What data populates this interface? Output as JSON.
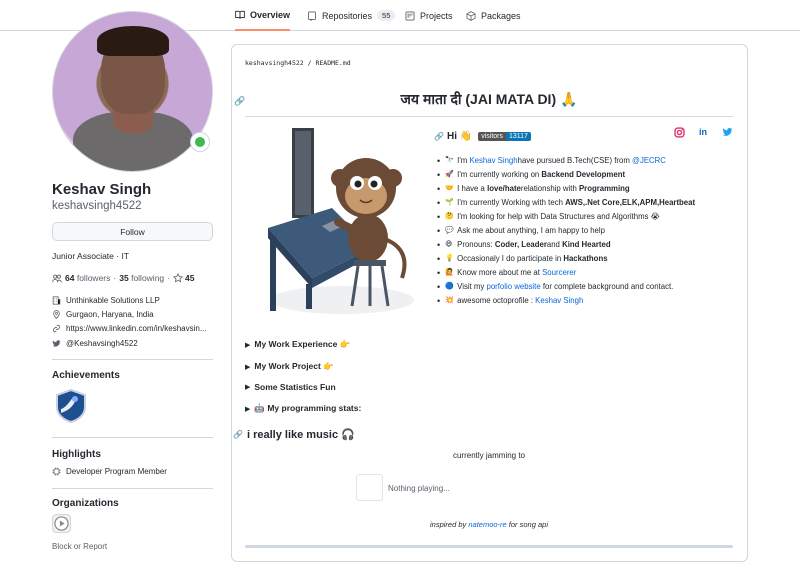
{
  "tabs": [
    {
      "label": "Overview",
      "icon": "book-icon"
    },
    {
      "label": "Repositories",
      "icon": "repo-icon",
      "count": "55"
    },
    {
      "label": "Projects",
      "icon": "project-icon"
    },
    {
      "label": "Packages",
      "icon": "package-icon"
    }
  ],
  "profile": {
    "name": "Keshav Singh",
    "login": "keshavsingh4522",
    "follow_label": "Follow",
    "bio": "Junior Associate · IT",
    "followers_count": "64",
    "followers_label": "followers",
    "following_count": "35",
    "following_label": "following",
    "separator": "·",
    "stars_count": "45",
    "company": "Unthinkable Solutions LLP",
    "location": "Gurgaon, Haryana, India",
    "website": "https://www.linkedin.com/in/keshavsin...",
    "twitter": "@Keshavsingh4522"
  },
  "sidebar": {
    "achievements_title": "Achievements",
    "highlights_title": "Highlights",
    "highlight_item": "Developer Program Member",
    "organizations_title": "Organizations",
    "block_label": "Block or Report"
  },
  "readme": {
    "breadcrumb_user": "keshavsingh4522",
    "breadcrumb_sep": " / ",
    "breadcrumb_file": "README.md",
    "heading": "जय माता दी (JAI MATA DI) 🙏",
    "hi": "Hi 👋",
    "visitors_label": "visitors",
    "visitors_count": "13117",
    "bullets": [
      {
        "emoji": "🔭",
        "pre": "I'm ",
        "link1": "Keshav Singh",
        "mid": " have pursued B.Tech(CSE) from ",
        "link2": "@JECRC",
        "post": ""
      },
      {
        "emoji": "🚀",
        "pre": "I'm currently working on ",
        "bold": "Backend Development",
        "post": ""
      },
      {
        "emoji": "🤝",
        "pre": "I have a ",
        "bold": "love/hate",
        "post": " relationship with ",
        "bold2": "Programming"
      },
      {
        "emoji": "🌱",
        "pre": "I'm currently Working with tech ",
        "bold": "AWS,.Net Core,ELK,APM,Heartbeat",
        "post": ""
      },
      {
        "emoji": "🤔",
        "pre": "I'm looking for help with Data Structures and Algorithms 😭",
        "post": ""
      },
      {
        "emoji": "💬",
        "pre": "Ask me about anything, I am happy to help",
        "post": ""
      },
      {
        "emoji": "😄",
        "pre": "Pronouns: ",
        "bold": "Coder, Leader",
        "post": " and ",
        "bold2": "Kind Hearted"
      },
      {
        "emoji": "💡",
        "pre": "Occasionaly I do participate in ",
        "bold": "Hackathons",
        "post": ""
      },
      {
        "emoji": "🙋",
        "pre": "Know more about me at ",
        "link1": "Sourcerer",
        "post": ""
      },
      {
        "emoji": "🔵",
        "pre": "Visit my ",
        "link1": "porfolio website",
        "post": " for complete background and contact."
      },
      {
        "emoji": "💥",
        "pre": "awesome octoprofile : ",
        "link1": "Keshav Singh",
        "post": ""
      }
    ],
    "details": [
      "My Work Experience 👉",
      "My Work Project 👉",
      "Some Statistics Fun",
      "🤖 My programming stats:"
    ],
    "music_heading": "i really like music 🎧",
    "jamming": "currently jamming to",
    "now_playing": "Nothing playing...",
    "inspired_pre": "inspired by ",
    "inspired_link": "natemoo-re",
    "inspired_post": " for song api"
  },
  "colors": {
    "accent": "#fd8c73",
    "link": "#0969da",
    "border": "#d0d7de",
    "status_green": "#3fb950",
    "visitors_badge": "#0e75b6",
    "instagram": "#e1306c",
    "linkedin": "#0a66c2",
    "twitter": "#1da1f2"
  }
}
